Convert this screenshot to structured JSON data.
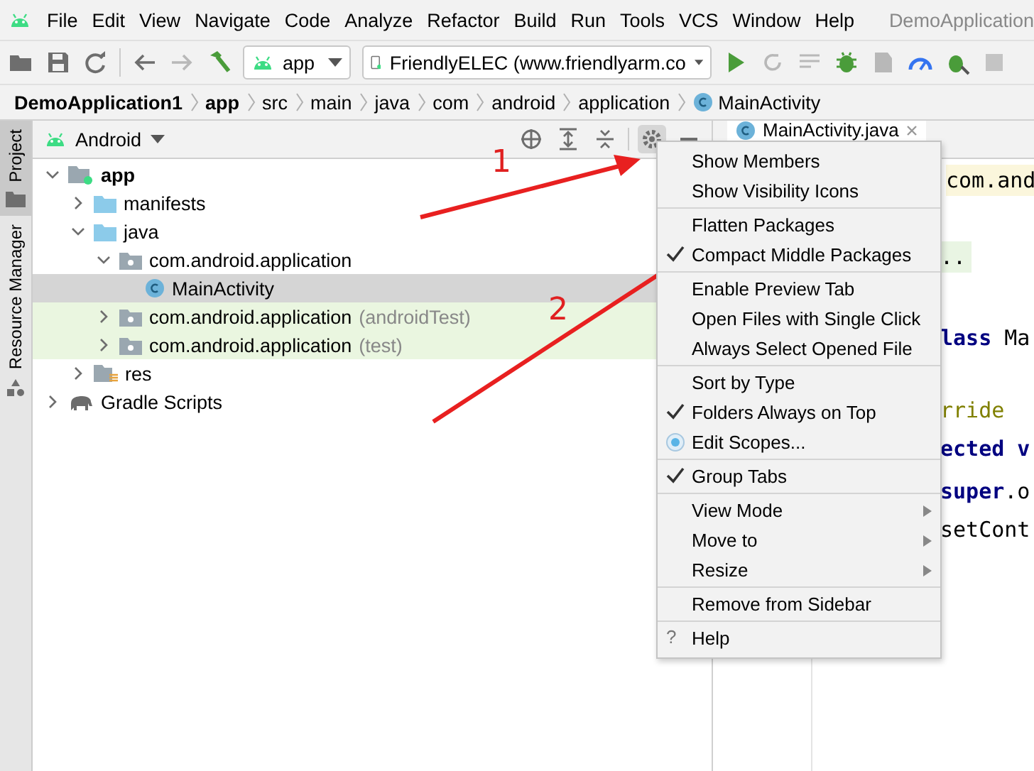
{
  "menu_bar": {
    "items": [
      "File",
      "Edit",
      "View",
      "Navigate",
      "Code",
      "Analyze",
      "Refactor",
      "Build",
      "Run",
      "Tools",
      "VCS",
      "Window",
      "Help"
    ],
    "title": "DemoApplication"
  },
  "toolbar": {
    "config": "app",
    "device": "FriendlyELEC (www.friendlyarm.co"
  },
  "breadcrumb": [
    {
      "label": "DemoApplication1",
      "bold": true
    },
    {
      "label": "app",
      "bold": true
    },
    {
      "label": "src",
      "bold": false
    },
    {
      "label": "main",
      "bold": false
    },
    {
      "label": "java",
      "bold": false
    },
    {
      "label": "com",
      "bold": false
    },
    {
      "label": "android",
      "bold": false
    },
    {
      "label": "application",
      "bold": false
    },
    {
      "label": "MainActivity",
      "bold": false,
      "kind": "class"
    }
  ],
  "side_tabs": [
    {
      "label": "Project",
      "selected": true
    },
    {
      "label": "Resource Manager",
      "selected": false
    }
  ],
  "project_panel": {
    "view": "Android",
    "tree": [
      {
        "label": "app",
        "kind": "module",
        "expanded": true,
        "selected": false,
        "children": [
          {
            "label": "manifests",
            "kind": "folder",
            "expanded": false,
            "selected": false
          },
          {
            "label": "java",
            "kind": "folder",
            "expanded": true,
            "selected": false,
            "children": [
              {
                "label": "com.android.application",
                "kind": "package",
                "expanded": true,
                "selected": false,
                "children": [
                  {
                    "label": "MainActivity",
                    "kind": "class",
                    "selected": true
                  }
                ]
              },
              {
                "label": "com.android.application",
                "hint": "(androidTest)",
                "kind": "test-package",
                "expanded": false,
                "selected": false
              },
              {
                "label": "com.android.application",
                "hint": "(test)",
                "kind": "test-package",
                "expanded": false,
                "selected": false
              }
            ]
          },
          {
            "label": "res",
            "kind": "res",
            "expanded": false,
            "selected": false
          }
        ]
      },
      {
        "label": "Gradle Scripts",
        "kind": "gradle",
        "expanded": false,
        "selected": false
      }
    ]
  },
  "editor": {
    "tab": "MainActivity.java",
    "lines": [
      {
        "text": "com.and",
        "kind": "import"
      },
      {
        "text": "..",
        "kind": "folded"
      },
      {
        "text": "**lass** Ma",
        "kind": "code"
      },
      {
        "text": "rride",
        "kind": "annotation"
      },
      {
        "text": "ected v",
        "kind": "keyword"
      },
      {
        "text": "**super**.o",
        "kind": "code"
      },
      {
        "text": "setCont",
        "kind": "code"
      }
    ]
  },
  "annotations": [
    {
      "label": "1"
    },
    {
      "label": "2"
    }
  ],
  "context_menu": {
    "groups": [
      [
        {
          "label": "Show Members",
          "kind": "check",
          "checked": false
        },
        {
          "label": "Show Visibility Icons",
          "kind": "check",
          "checked": false
        }
      ],
      [
        {
          "label": "Flatten Packages",
          "kind": "check",
          "checked": false
        },
        {
          "label": "Compact Middle Packages",
          "kind": "check",
          "checked": true
        }
      ],
      [
        {
          "label": "Enable Preview Tab",
          "kind": "check",
          "checked": false
        },
        {
          "label": "Open Files with Single Click",
          "kind": "check",
          "checked": false
        },
        {
          "label": "Always Select Opened File",
          "kind": "check",
          "checked": false
        }
      ],
      [
        {
          "label": "Sort by Type",
          "kind": "check",
          "checked": false
        },
        {
          "label": "Folders Always on Top",
          "kind": "check",
          "checked": true
        },
        {
          "label": "Edit Scopes...",
          "kind": "radio"
        }
      ],
      [
        {
          "label": "Group Tabs",
          "kind": "check",
          "checked": true
        }
      ],
      [
        {
          "label": "View Mode",
          "kind": "submenu"
        },
        {
          "label": "Move to",
          "kind": "submenu"
        },
        {
          "label": "Resize",
          "kind": "submenu"
        }
      ],
      [
        {
          "label": "Remove from Sidebar",
          "kind": "plain"
        }
      ],
      [
        {
          "label": "Help",
          "kind": "help",
          "icon": "?"
        }
      ]
    ]
  }
}
